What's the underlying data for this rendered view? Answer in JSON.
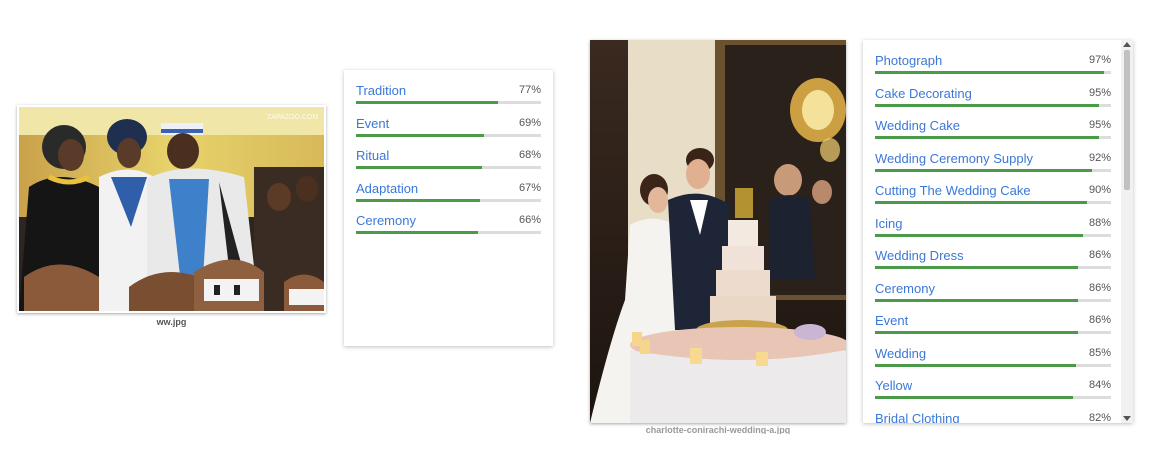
{
  "image1": {
    "caption": "ww.jpg",
    "watermark": "ZAPAZOO.COM",
    "labels": [
      {
        "name": "Tradition",
        "score": "77%",
        "value": 77
      },
      {
        "name": "Event",
        "score": "69%",
        "value": 69
      },
      {
        "name": "Ritual",
        "score": "68%",
        "value": 68
      },
      {
        "name": "Adaptation",
        "score": "67%",
        "value": 67
      },
      {
        "name": "Ceremony",
        "score": "66%",
        "value": 66
      }
    ]
  },
  "image2": {
    "caption": "charlotte-conirachi-wedding-a.jpg",
    "labels": [
      {
        "name": "Photograph",
        "score": "97%",
        "value": 97
      },
      {
        "name": "Cake Decorating",
        "score": "95%",
        "value": 95
      },
      {
        "name": "Wedding Cake",
        "score": "95%",
        "value": 95
      },
      {
        "name": "Wedding Ceremony Supply",
        "score": "92%",
        "value": 92
      },
      {
        "name": "Cutting The Wedding Cake",
        "score": "90%",
        "value": 90
      },
      {
        "name": "Icing",
        "score": "88%",
        "value": 88
      },
      {
        "name": "Wedding Dress",
        "score": "86%",
        "value": 86
      },
      {
        "name": "Ceremony",
        "score": "86%",
        "value": 86
      },
      {
        "name": "Event",
        "score": "86%",
        "value": 86
      },
      {
        "name": "Wedding",
        "score": "85%",
        "value": 85
      },
      {
        "name": "Yellow",
        "score": "84%",
        "value": 84
      },
      {
        "name": "Bridal Clothing",
        "score": "82%",
        "value": 82
      }
    ]
  },
  "colors": {
    "label_link": "#3b78d8",
    "bar_fill": "#4a9a4a",
    "bar_track": "#dcdcdc"
  }
}
